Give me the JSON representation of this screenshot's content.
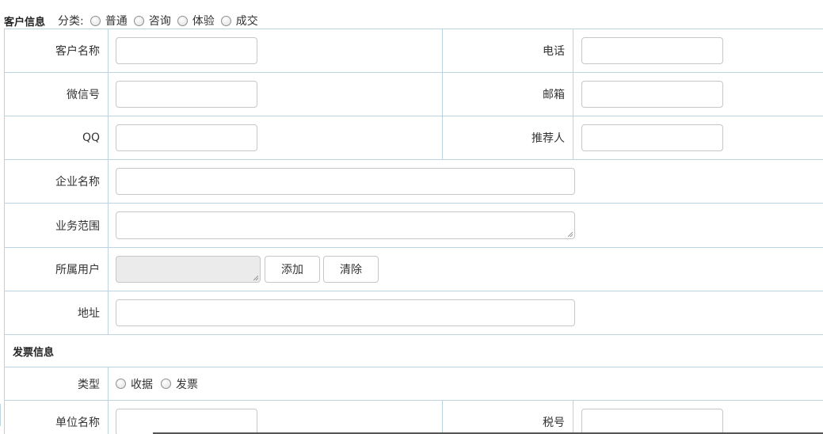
{
  "header": {
    "title": "客户信息",
    "category_label": "分类:",
    "category_options": [
      "普通",
      "咨询",
      "体验",
      "成交"
    ]
  },
  "customer": {
    "name_label": "客户名称",
    "phone_label": "电话",
    "wechat_label": "微信号",
    "email_label": "邮箱",
    "qq_label": "QQ",
    "referrer_label": "推荐人",
    "company_label": "企业名称",
    "business_label": "业务范围",
    "owner_label": "所属用户",
    "add_button": "添加",
    "clear_button": "清除",
    "address_label": "地址"
  },
  "invoice": {
    "section_title": "发票信息",
    "type_label": "类型",
    "type_options": [
      "收据",
      "发票"
    ],
    "unit_label": "单位名称",
    "tax_label": "税号"
  },
  "colors": {
    "border": "#bcd3e0",
    "input_border": "#c7c7c7",
    "disabled_bg": "#ebebeb"
  }
}
